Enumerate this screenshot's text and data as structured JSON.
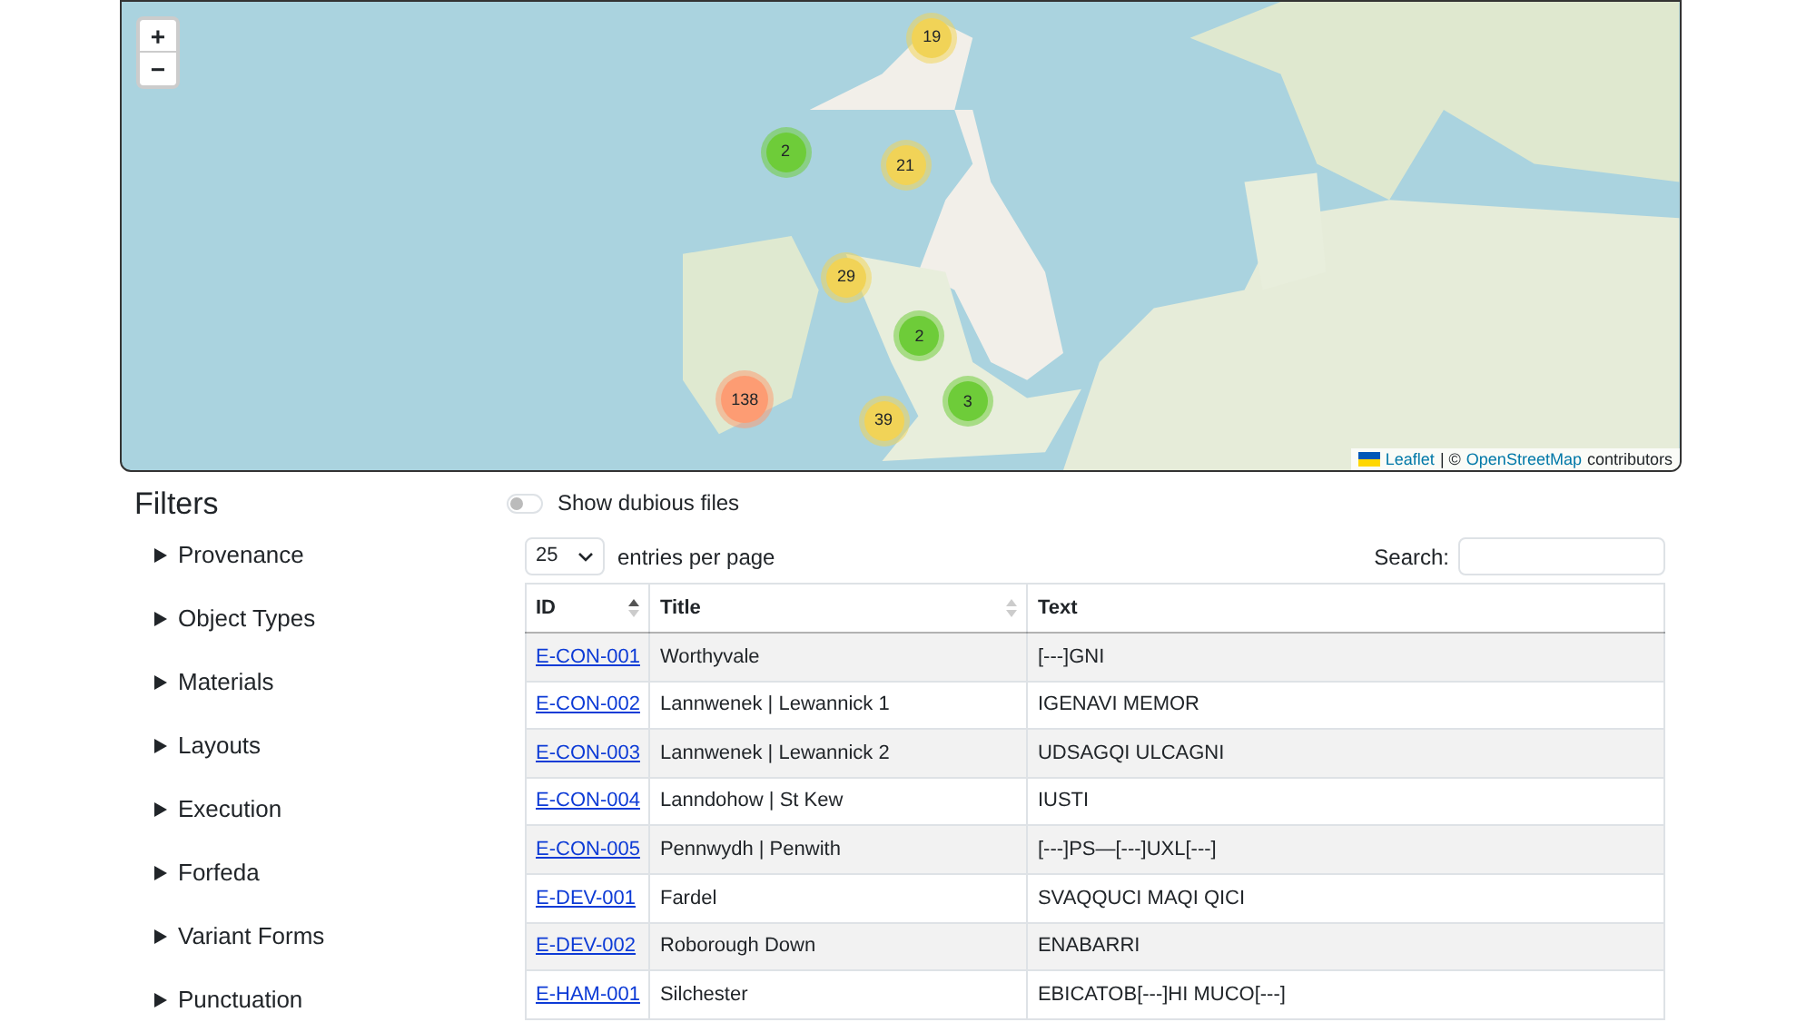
{
  "map": {
    "zoom_in": "+",
    "zoom_out": "−",
    "clusters": [
      {
        "count": "19",
        "color": "#f1d357"
      },
      {
        "count": "2",
        "color": "#6ecc39"
      },
      {
        "count": "21",
        "color": "#f1d357"
      },
      {
        "count": "29",
        "color": "#f1d357"
      },
      {
        "count": "2",
        "color": "#6ecc39"
      },
      {
        "count": "138",
        "color": "#fd9c73"
      },
      {
        "count": "3",
        "color": "#6ecc39"
      },
      {
        "count": "39",
        "color": "#f1d357"
      }
    ],
    "attribution": {
      "leaflet": "Leaflet",
      "separator": "| ©",
      "osm": "OpenStreetMap",
      "suffix": "contributors"
    }
  },
  "filters": {
    "title": "Filters",
    "items": [
      {
        "label": "Provenance",
        "expanded": false
      },
      {
        "label": "Object Types",
        "expanded": false
      },
      {
        "label": "Materials",
        "expanded": false
      },
      {
        "label": "Layouts",
        "expanded": false
      },
      {
        "label": "Execution",
        "expanded": false
      },
      {
        "label": "Forfeda",
        "expanded": false
      },
      {
        "label": "Variant Forms",
        "expanded": false
      },
      {
        "label": "Punctuation",
        "expanded": false
      }
    ]
  },
  "dubious_toggle": {
    "label": "Show dubious files",
    "on": false
  },
  "page_length": {
    "value": "25",
    "label": "entries per page"
  },
  "search": {
    "label": "Search:"
  },
  "table": {
    "columns": [
      {
        "label": "ID",
        "sorted": true
      },
      {
        "label": "Title",
        "sorted": false
      },
      {
        "label": "Text"
      }
    ],
    "rows": [
      [
        "E-CON-001",
        "Worthyvale",
        "[---]GNI"
      ],
      [
        "E-CON-002",
        "Lannwenek | Lewannick 1",
        "IGENAVI MEMOR"
      ],
      [
        "E-CON-003",
        "Lannwenek | Lewannick 2",
        "UDSAGQI ULCAGNI"
      ],
      [
        "E-CON-004",
        "Lanndohow | St Kew",
        "IUSTI"
      ],
      [
        "E-CON-005",
        "Pennwydh | Penwith",
        "[---]PS—[---]UXL[---]"
      ],
      [
        "E-DEV-001",
        "Fardel",
        "SVAQQUCI MAQI QICI"
      ],
      [
        "E-DEV-002",
        "Roborough Down",
        "ENABARRI"
      ],
      [
        "E-HAM-001",
        "Silchester",
        "EBICATOB[---]HI MUCO[---]"
      ]
    ]
  }
}
